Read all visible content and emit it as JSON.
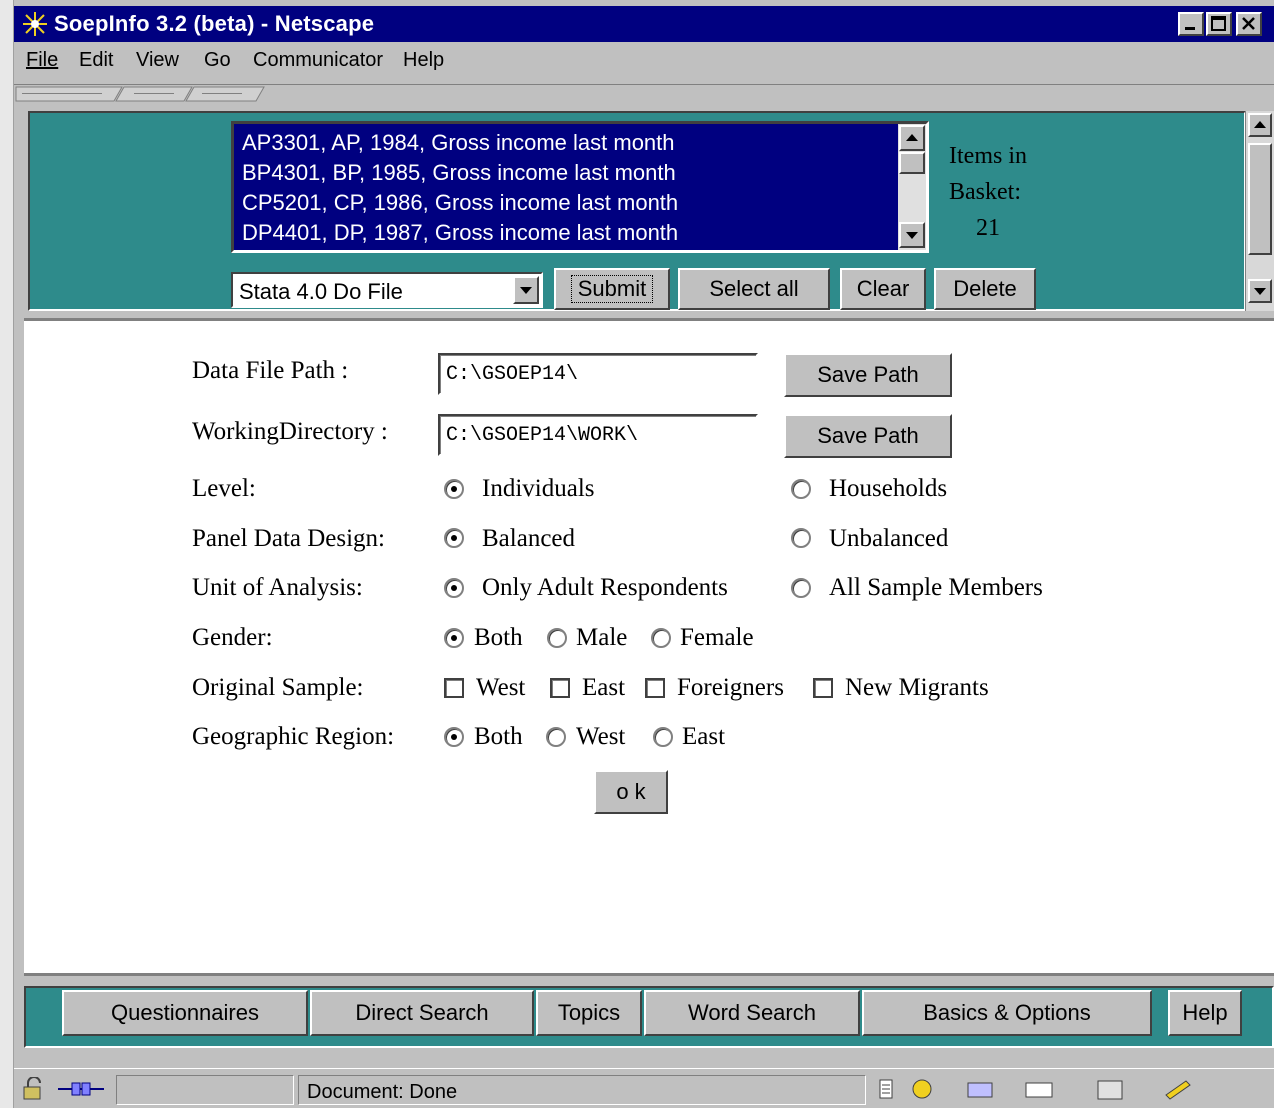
{
  "window": {
    "title": "SoepInfo 3.2 (beta) - Netscape"
  },
  "menu": [
    "File",
    "Edit",
    "View",
    "Go",
    "Communicator",
    "Help"
  ],
  "basket_list": {
    "items": [
      "AP3301, AP, 1984, Gross income last month",
      "BP4301, BP, 1985, Gross income last month",
      "CP5201, CP, 1986, Gross income last month",
      "DP4401, DP, 1987, Gross income last month"
    ]
  },
  "basket_info": {
    "label_line1": "Items in",
    "label_line2": "Basket:",
    "count": "21"
  },
  "export": {
    "format_selected": "Stata 4.0 Do File",
    "submit": "Submit",
    "select_all": "Select all",
    "clear": "Clear",
    "delete": "Delete"
  },
  "form": {
    "data_file_path": {
      "label": "Data File Path :",
      "value": "C:\\GSOEP14\\",
      "button": "Save Path"
    },
    "working_directory": {
      "label": "WorkingDirectory :",
      "value": "C:\\GSOEP14\\WORK\\",
      "button": "Save Path"
    },
    "level": {
      "label": "Level:",
      "options": [
        "Individuals",
        "Households"
      ],
      "selected": "Individuals"
    },
    "panel_design": {
      "label": "Panel Data Design:",
      "options": [
        "Balanced",
        "Unbalanced"
      ],
      "selected": "Balanced"
    },
    "unit_of_analysis": {
      "label": "Unit of Analysis:",
      "options": [
        "Only Adult Respondents",
        "All Sample Members"
      ],
      "selected": "Only Adult Respondents"
    },
    "gender": {
      "label": "Gender:",
      "options": [
        "Both",
        "Male",
        "Female"
      ],
      "selected": "Both"
    },
    "original_sample": {
      "label": "Original Sample:",
      "options": [
        "West",
        "East",
        "Foreigners",
        "New Migrants"
      ],
      "checked": []
    },
    "geographic_region": {
      "label": "Geographic Region:",
      "options": [
        "Both",
        "West",
        "East"
      ],
      "selected": "Both"
    },
    "ok": "o k"
  },
  "nav": [
    "Questionnaires",
    "Direct Search",
    "Topics",
    "Word Search",
    "Basics & Options",
    "Help"
  ],
  "status": {
    "text": "Document: Done"
  },
  "icons": [
    "netscape-icon",
    "lock-icon",
    "connection-icon",
    "component-bar-icons"
  ]
}
